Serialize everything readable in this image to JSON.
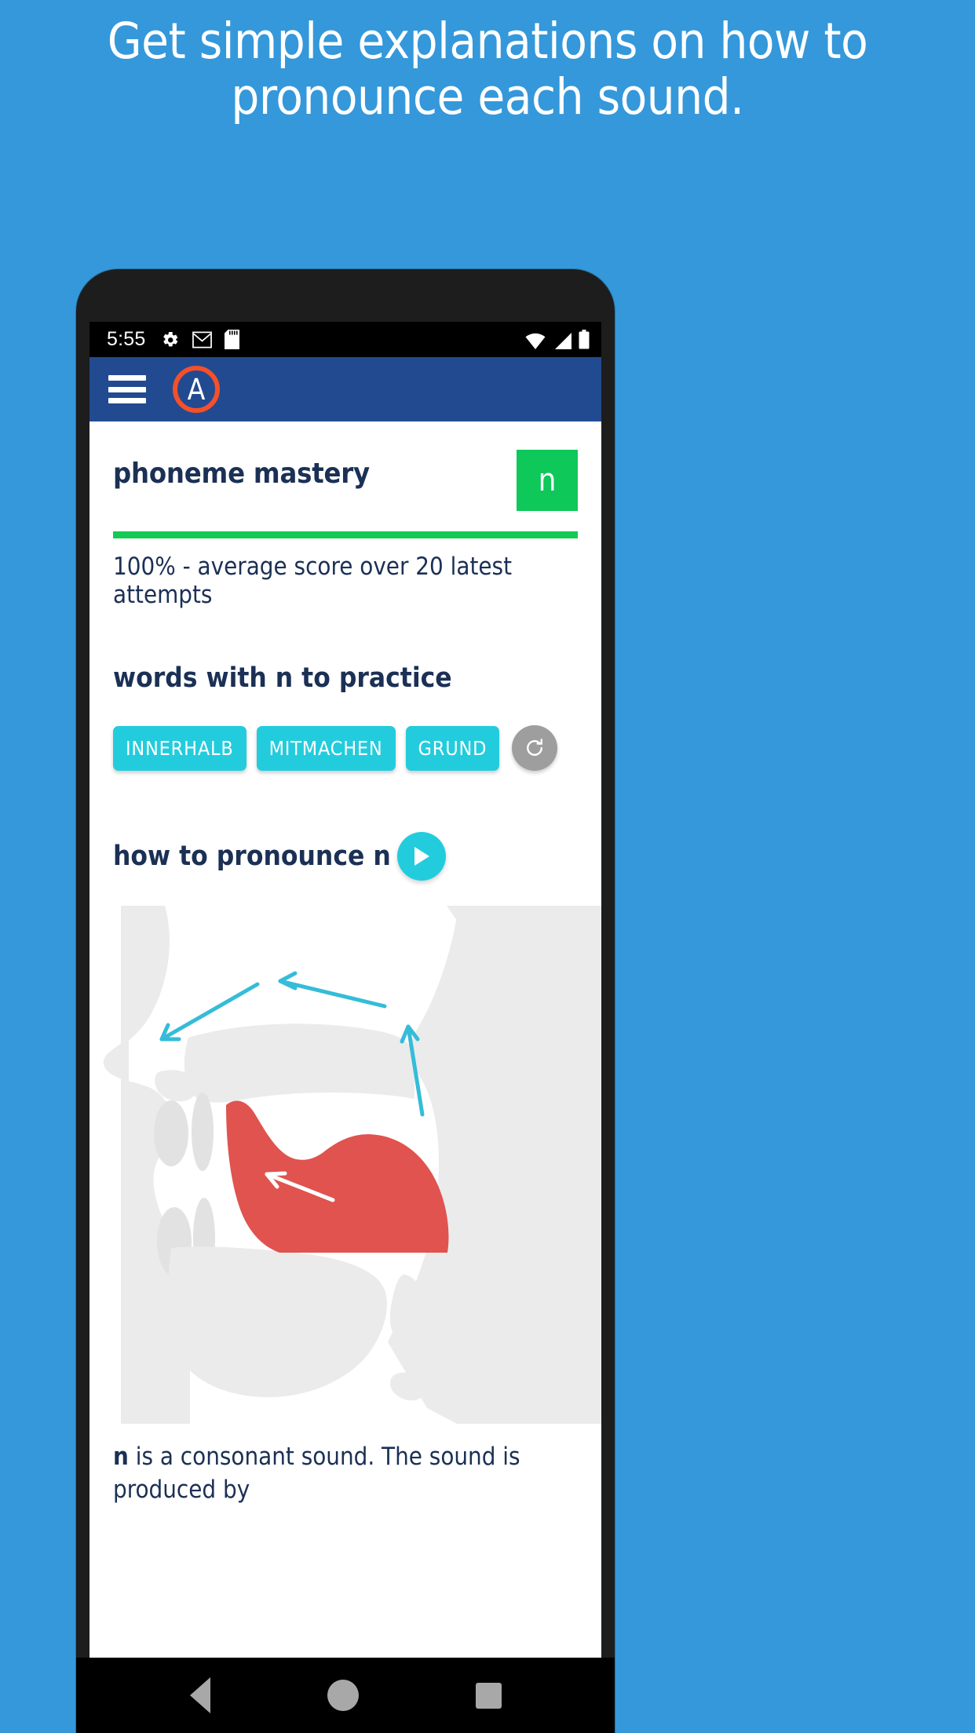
{
  "promo": {
    "headline": "Get simple explanations on how to pronounce each sound."
  },
  "colors": {
    "background": "#3498db",
    "appbar": "#224a91",
    "accent_cyan": "#22ccdd",
    "accent_orange": "#f4502a",
    "mastery_green": "#0ec85a",
    "text_navy": "#1b3055",
    "tongue_red": "#e0534f",
    "anatomy_gray": "#ebebeb"
  },
  "status_bar": {
    "time": "5:55",
    "left_icons": [
      "gear-icon",
      "gmail-icon",
      "sd-card-icon"
    ],
    "right_icons": [
      "wifi-icon",
      "signal-icon",
      "battery-icon"
    ]
  },
  "app_bar": {
    "menu_icon": "hamburger-menu-icon",
    "logo_letter": "A"
  },
  "mastery": {
    "title": "phoneme mastery",
    "phoneme": "n",
    "progress_percent": 100,
    "caption": "100% - average score over 20 latest attempts"
  },
  "practice": {
    "heading": "words with n to practice",
    "words": [
      "INNERHALB",
      "MITMACHEN",
      "GRUND"
    ],
    "refresh_icon": "refresh-icon"
  },
  "pronounce": {
    "heading": "how to pronounce n",
    "play_icon": "play-icon",
    "diagram_name": "mouth-sagittal-diagram",
    "description_bold": "n",
    "description_rest": " is a consonant sound. The sound is produced by"
  },
  "nav_bar": {
    "items": [
      "back-button",
      "home-button",
      "recents-button"
    ]
  }
}
